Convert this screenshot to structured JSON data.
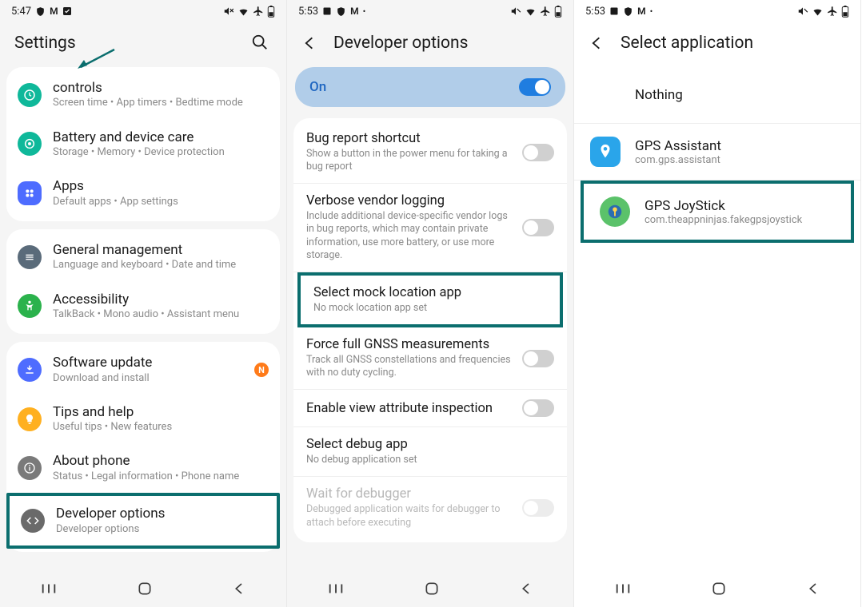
{
  "phone1": {
    "status_time": "5:47",
    "header_title": "Settings",
    "items": [
      {
        "title": "controls",
        "sub": "Screen time  •  App timers  •  Bedtime mode"
      },
      {
        "title": "Battery and device care",
        "sub": "Storage  •  Memory  •  Device protection"
      },
      {
        "title": "Apps",
        "sub": "Default apps  •  App settings"
      },
      {
        "title": "General management",
        "sub": "Language and keyboard  •  Date and time"
      },
      {
        "title": "Accessibility",
        "sub": "TalkBack  •  Mono audio  •  Assistant menu"
      },
      {
        "title": "Software update",
        "sub": "Download and install"
      },
      {
        "title": "Tips and help",
        "sub": "Useful tips  •  New features"
      },
      {
        "title": "About phone",
        "sub": "Status  •  Legal information  •  Phone name"
      },
      {
        "title": "Developer options",
        "sub": "Developer options"
      }
    ],
    "badge_n": "N"
  },
  "phone2": {
    "status_time": "5:53",
    "header_title": "Developer options",
    "on_label": "On",
    "items": [
      {
        "title": "Bug report shortcut",
        "sub": "Show a button in the power menu for taking a bug report"
      },
      {
        "title": "Verbose vendor logging",
        "sub": "Include additional device-specific vendor logs in bug reports, which may contain private information, use more battery, or use more storage."
      },
      {
        "title": "Select mock location app",
        "sub": "No mock location app set"
      },
      {
        "title": "Force full GNSS measurements",
        "sub": "Track all GNSS constellations and frequencies with no duty cycling."
      },
      {
        "title": "Enable view attribute inspection",
        "sub": ""
      },
      {
        "title": "Select debug app",
        "sub": "No debug application set"
      },
      {
        "title": "Wait for debugger",
        "sub": "Debugged application waits for debugger to attach before executing"
      }
    ]
  },
  "phone3": {
    "status_time": "5:53",
    "header_title": "Select application",
    "apps": [
      {
        "title": "Nothing",
        "sub": ""
      },
      {
        "title": "GPS Assistant",
        "sub": "com.gps.assistant"
      },
      {
        "title": "GPS JoyStick",
        "sub": "com.theappninjas.fakegpsjoystick"
      }
    ]
  }
}
